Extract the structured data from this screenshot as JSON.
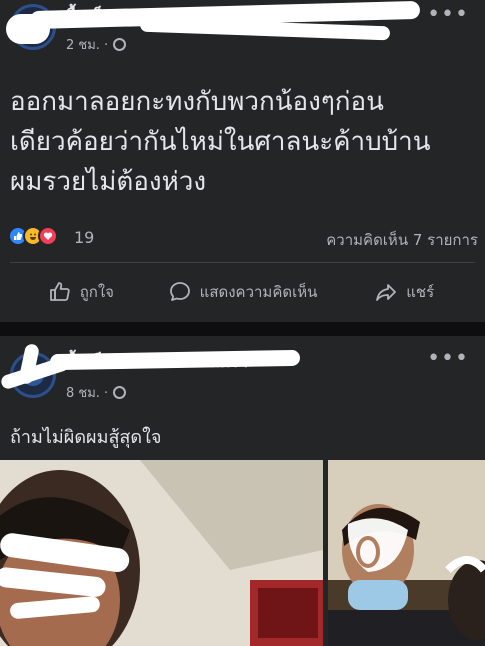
{
  "post1": {
    "author": "ลื้พเซ็บอภ อย่านอกว่าเศร้า",
    "time": "2 ชม. ·",
    "text_lines": [
      "ออกมาลอยกะทงกับพวกน้องๆก่อน",
      "เดียวค้อยว่ากันไหม่ในศาลนะค้าบบ้าน",
      "ผมรวยไม่ต้องห่วง"
    ],
    "reaction_count": "19",
    "comment_count": "ความคิดเห็น 7 รายการ",
    "actions": {
      "like": "ถูกใจ",
      "comment": "แสดงความคิดเห็น",
      "share": "แชร์"
    }
  },
  "post2": {
    "author": "ลื้พเซ็บอภ อย่านอกว่าเศร้า",
    "time": "8 ชม. ·",
    "text": "ถ้ามไม่ผิดผมสู้สุดใจ"
  },
  "icons": [
    "more-icon",
    "globe-icon",
    "like-icon",
    "comment-icon",
    "share-icon"
  ],
  "colors": {
    "background": "#242526",
    "text": "#e4e6eb",
    "secondary": "#b0b3b8",
    "like_blue": "#2d88ff",
    "love_red": "#f33e58",
    "haha_yellow": "#f7b928"
  }
}
